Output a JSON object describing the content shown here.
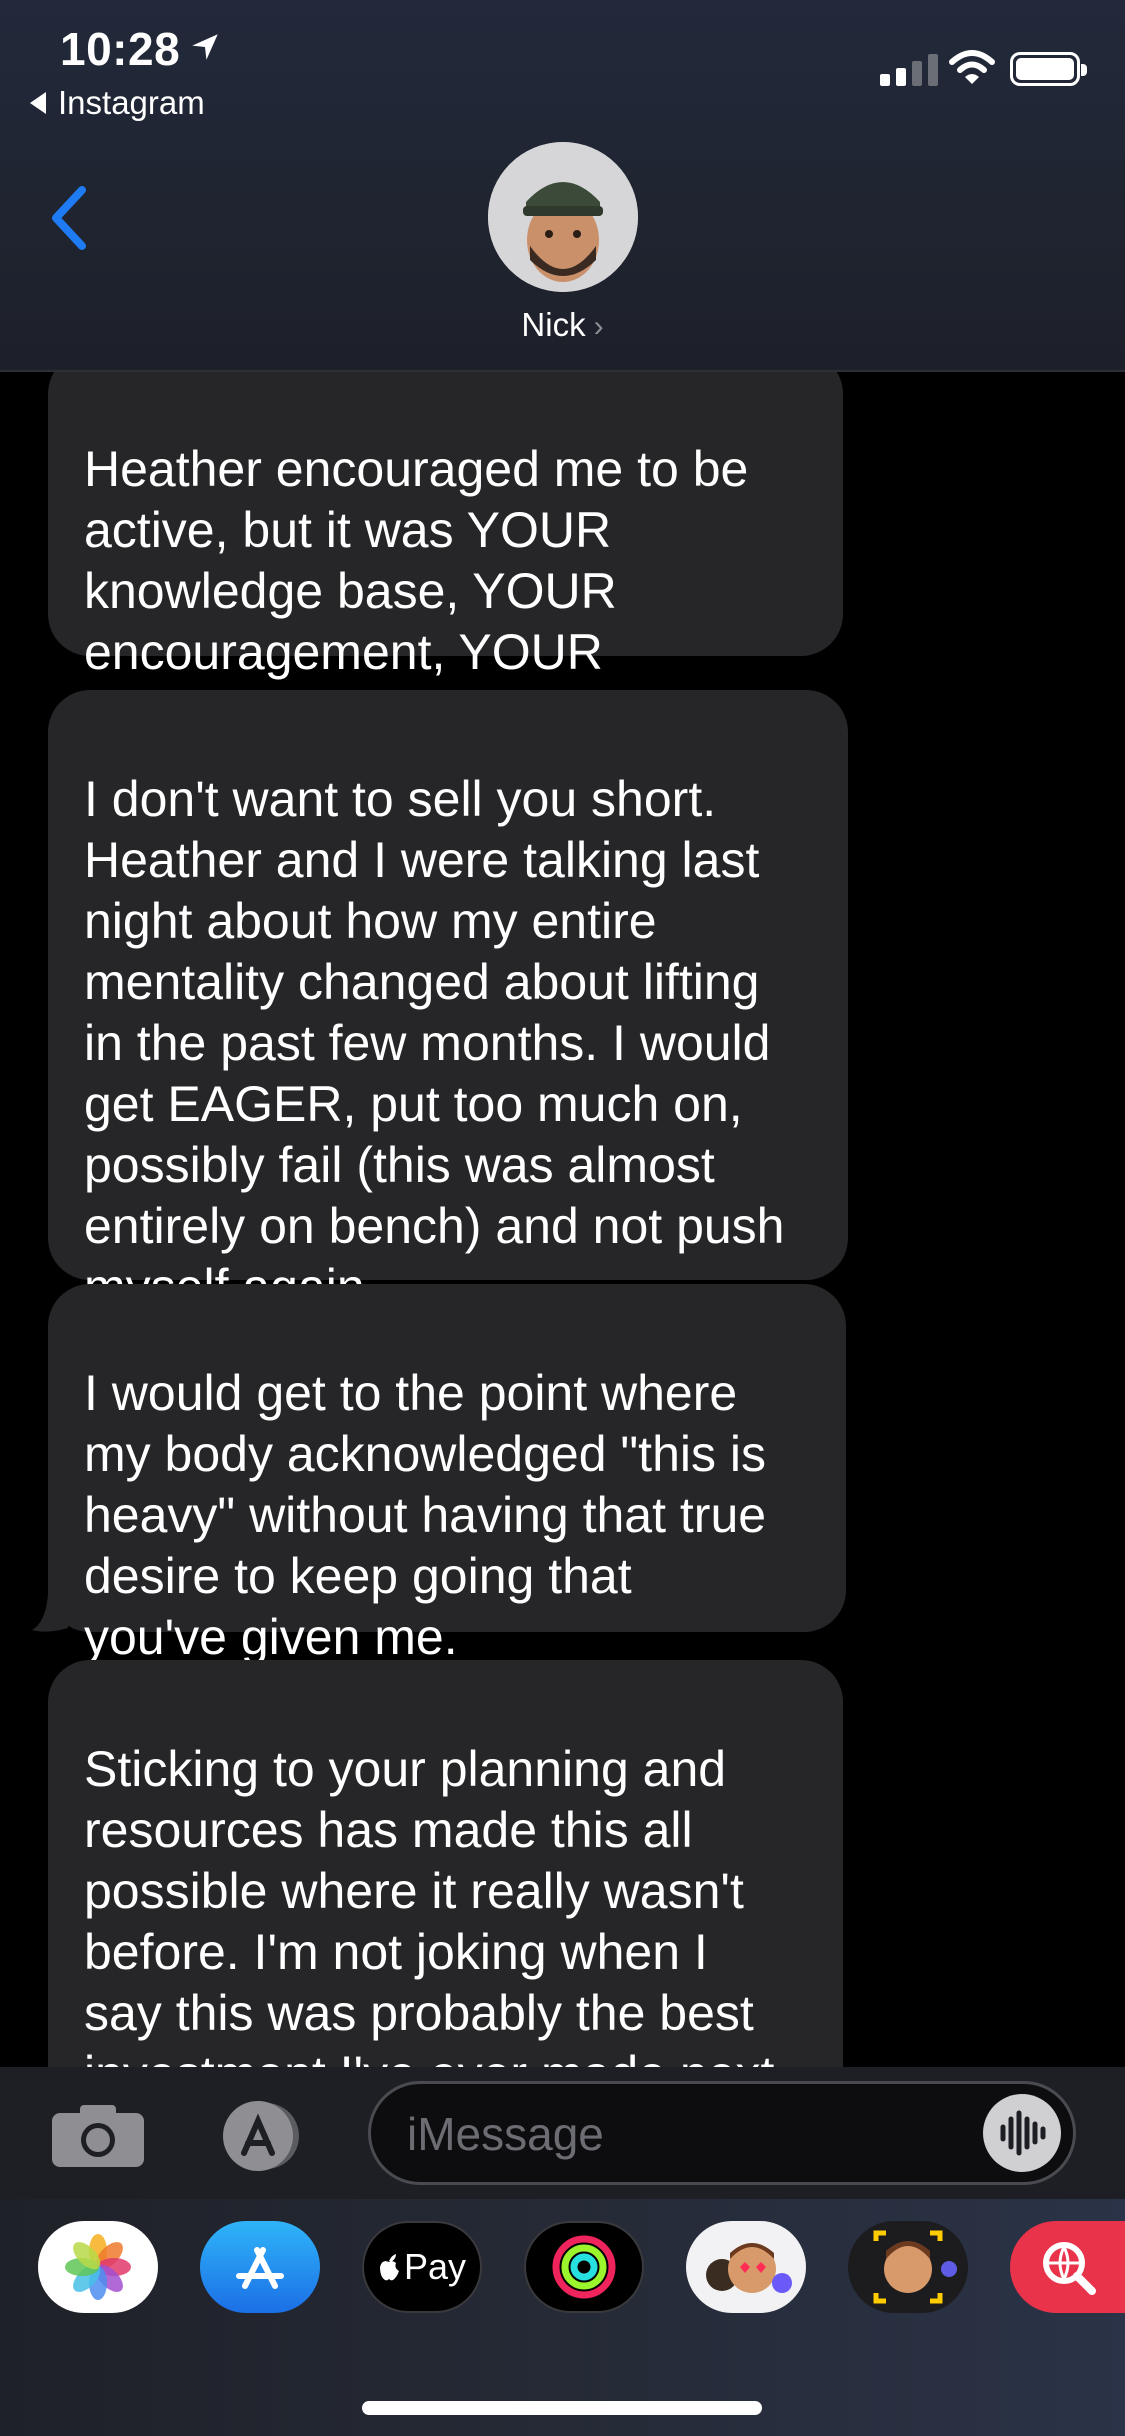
{
  "status_bar": {
    "time": "10:28",
    "back_app": "Instagram"
  },
  "header": {
    "contact_name": "Nick",
    "chevron": "›"
  },
  "messages": [
    {
      "sender": "contact",
      "text": "Heather encouraged me to be\nactive, but it was YOUR\nknowledge base, YOUR\nencouragement, YOUR\nplanning"
    },
    {
      "sender": "contact",
      "text": "I don't want to sell you short.\nHeather and I were talking last\nnight about how my entire\nmentality changed about lifting\nin the past few months. I would\nget EAGER, put too much on,\npossibly fail (this was almost\nentirely on bench) and not push\nmyself again"
    },
    {
      "sender": "contact",
      "text": "I would get to the point where\nmy body acknowledged \"this is\nheavy\" without having that true\ndesire to keep going that\nyou've given me."
    },
    {
      "sender": "contact",
      "text": "Sticking to your planning and\nresources has made this all\npossible where it really wasn't\nbefore. I'm not joking when I\nsay this was probably the best\ninvestment I've ever made next\nto my dog or my wife lo"
    }
  ],
  "compose": {
    "placeholder": "iMessage"
  },
  "app_drawer": {
    "apps": [
      {
        "icon": "photos-icon",
        "label": ""
      },
      {
        "icon": "app-store-icon",
        "label": ""
      },
      {
        "icon": "apple-pay-icon",
        "label": "Pay"
      },
      {
        "icon": "activity-icon",
        "label": ""
      },
      {
        "icon": "memoji-stickers-icon",
        "label": ""
      },
      {
        "icon": "memoji-camera-icon",
        "label": ""
      },
      {
        "icon": "web-search-icon",
        "label": ""
      }
    ]
  },
  "colors": {
    "bubble_received": "#262628",
    "accent_blue": "#1e7bf4",
    "background": "#000000"
  }
}
